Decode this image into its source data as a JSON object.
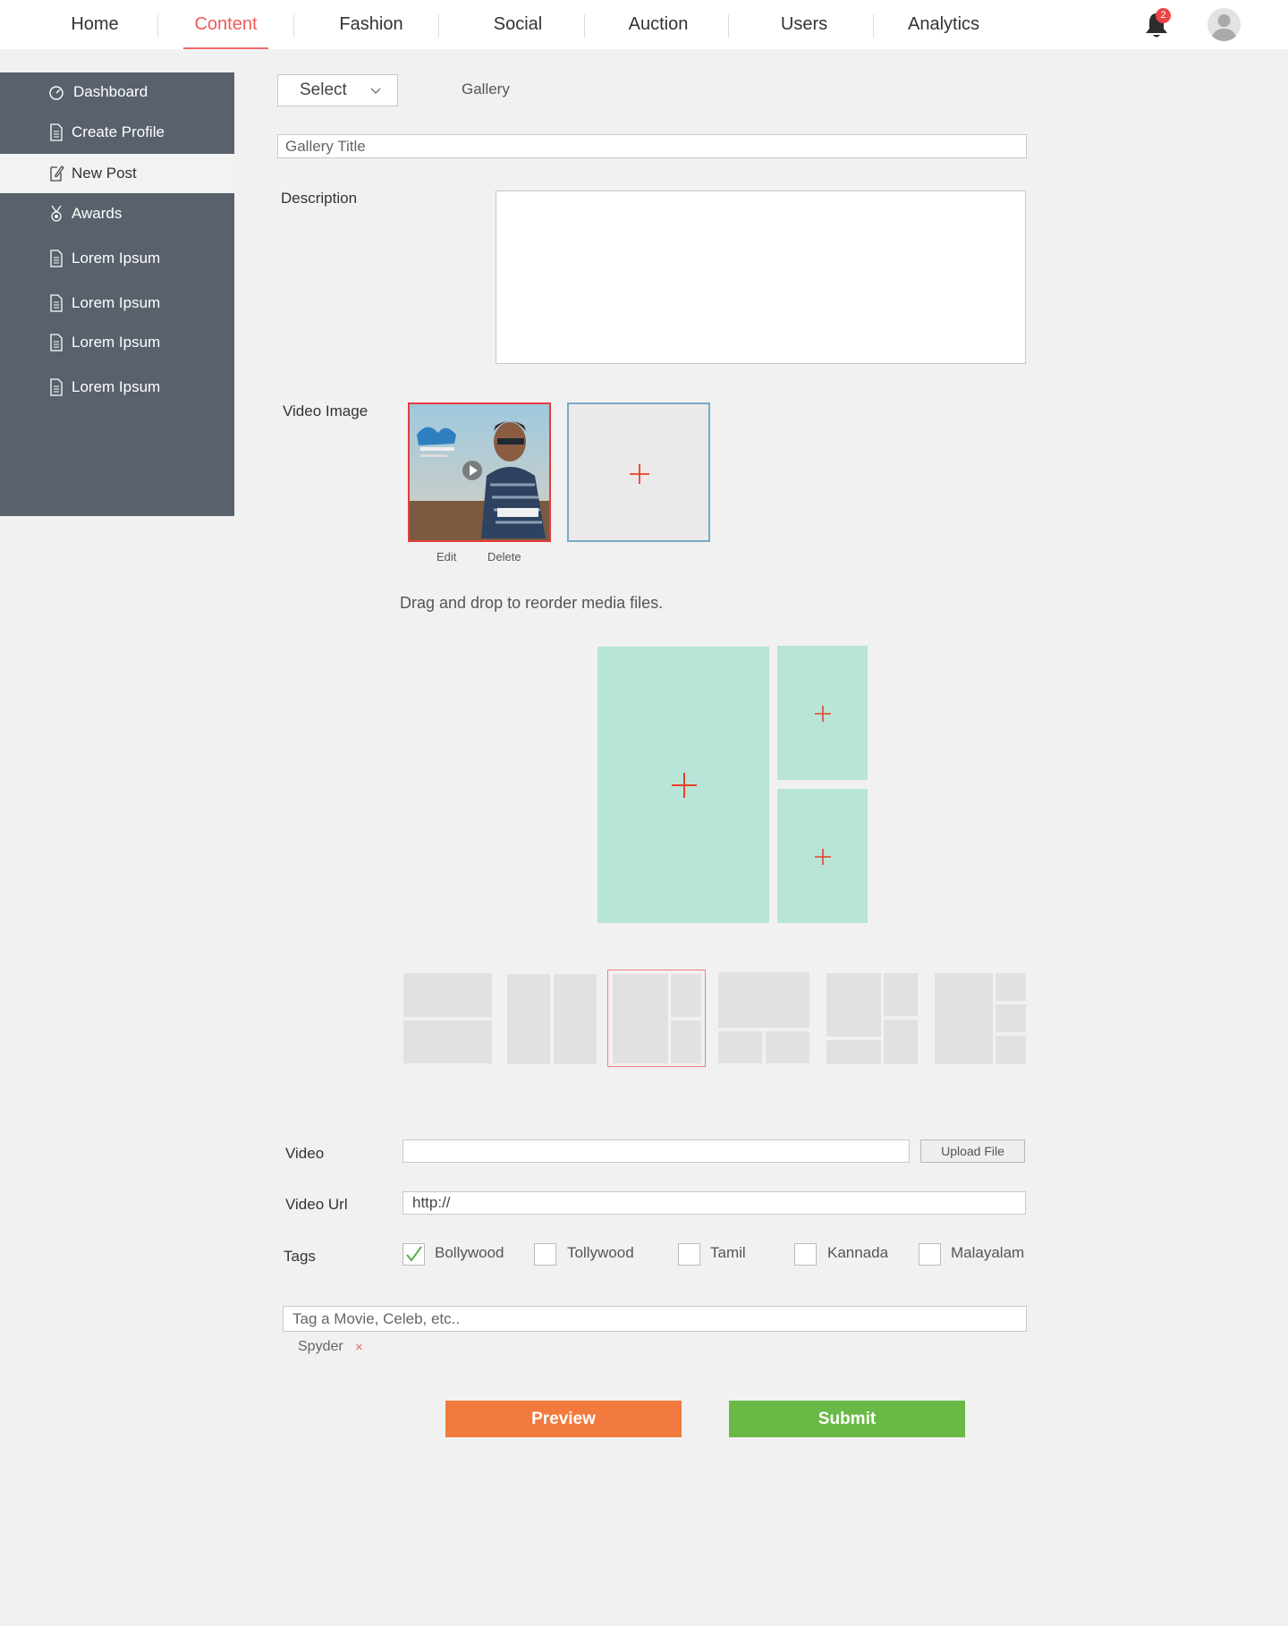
{
  "nav": {
    "items": [
      {
        "label": "Home"
      },
      {
        "label": "Content"
      },
      {
        "label": "Fashion"
      },
      {
        "label": "Social"
      },
      {
        "label": "Auction"
      },
      {
        "label": "Users"
      },
      {
        "label": "Analytics"
      }
    ],
    "active": "Content",
    "notification_count": "2",
    "accent_color": "#ee5a5a"
  },
  "sidebar": {
    "items": [
      {
        "label": "Dashboard",
        "icon": "dashboard-icon"
      },
      {
        "label": "Create Profile",
        "icon": "document-icon"
      },
      {
        "label": "New Post",
        "icon": "edit-icon"
      },
      {
        "label": "Awards",
        "icon": "medal-icon"
      },
      {
        "label": "Lorem Ipsum",
        "icon": "document-icon"
      },
      {
        "label": "Lorem Ipsum",
        "icon": "document-icon"
      },
      {
        "label": "Lorem Ipsum",
        "icon": "document-icon"
      },
      {
        "label": "Lorem Ipsum",
        "icon": "document-icon"
      }
    ],
    "active": "New Post",
    "background": "#58616c"
  },
  "form": {
    "type_select": "Select",
    "type_label": "Gallery",
    "title_placeholder": "Gallery Title",
    "description_label": "Description",
    "video_image_label": "Video Image",
    "edit_label": "Edit",
    "delete_label": "Delete",
    "reorder_hint": "Drag and drop to reorder media files.",
    "video_label": "Video",
    "upload_label": "Upload File",
    "video_url_label": "Video Url",
    "video_url_value": "http://",
    "tags_label": "Tags",
    "tags": [
      {
        "label": "Bollywood",
        "checked": true
      },
      {
        "label": "Tollywood",
        "checked": false
      },
      {
        "label": "Tamil",
        "checked": false
      },
      {
        "label": "Kannada",
        "checked": false
      },
      {
        "label": "Malayalam",
        "checked": false
      }
    ],
    "tag_search_placeholder": "Tag a Movie, Celeb, etc..",
    "tag_chips": [
      {
        "label": "Spyder",
        "remove": "×"
      }
    ],
    "preview_label": "Preview",
    "submit_label": "Submit",
    "preview_color": "#f27a3e",
    "submit_color": "#6ab946",
    "selected_layout": 3
  }
}
